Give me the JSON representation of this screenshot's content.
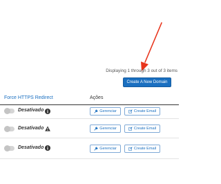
{
  "list_info": {
    "display_text": "Displaying 1 through 3 out of 3 items"
  },
  "toolbar": {
    "create_domain_label": "Create A New Domain"
  },
  "table": {
    "columns": [
      "Force HTTPS Redirect",
      "Ações"
    ],
    "rows": [
      {
        "status": "Desativado",
        "status_icon": "info-icon",
        "manage_label": "Gerenciar",
        "email_label": "Create Email"
      },
      {
        "status": "Desativado",
        "status_icon": "warning-icon",
        "manage_label": "Gerenciar",
        "email_label": "Create Email"
      },
      {
        "status": "Desativado",
        "status_icon": "info-icon",
        "manage_label": "Gerenciar",
        "email_label": "Create Email"
      }
    ]
  },
  "colors": {
    "primary": "#1a6fc0",
    "annotation_arrow": "#e8341c"
  }
}
